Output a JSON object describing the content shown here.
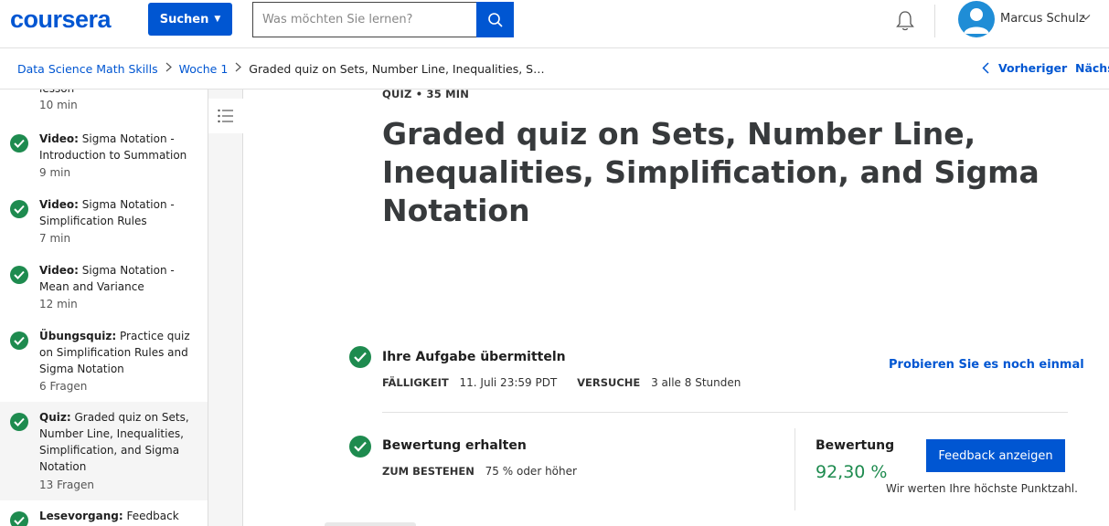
{
  "header": {
    "logo": "coursera",
    "explore_label": "Suchen",
    "search_placeholder": "Was möchten Sie lernen?",
    "user_name": "Marcus Schulz"
  },
  "breadcrumb": {
    "course": "Data Science Math Skills",
    "week": "Woche 1",
    "current": "Graded quiz on Sets, Number Line, Inequalities, S…",
    "prev_label": "Vorheriger",
    "next_label": "Nächs"
  },
  "sidebar": {
    "partial_top": {
      "text": "lesson",
      "meta": "10 min"
    },
    "items": [
      {
        "type": "Video:",
        "title": "Sigma Notation - Introduction to Summation",
        "meta": "9 min"
      },
      {
        "type": "Video:",
        "title": "Sigma Notation - Simplification Rules",
        "meta": "7 min"
      },
      {
        "type": "Video:",
        "title": "Sigma Notation - Mean and Variance",
        "meta": "12 min"
      },
      {
        "type": "Übungsquiz:",
        "title": "Practice quiz on Simplification Rules and Sigma Notation",
        "meta": "6 Fragen"
      },
      {
        "type": "Quiz:",
        "title": "Graded quiz on Sets, Number Line, Inequalities, Simplification, and Sigma Notation",
        "meta": "13 Fragen"
      },
      {
        "type": "Lesevorgang:",
        "title": "Feedback",
        "meta": ""
      }
    ]
  },
  "main": {
    "tag": "QUIZ • 35 MIN",
    "title": "Graded quiz on Sets, Number Line, Inequalities, Simplification, and Sigma Notation",
    "submit": {
      "title": "Ihre Aufgabe übermitteln",
      "due_label": "FÄLLIGKEIT",
      "due_value": "11. Juli 23:59 PDT",
      "attempts_label": "VERSUCHE",
      "attempts_value": "3 alle 8 Stunden",
      "retry_label": "Probieren Sie es noch einmal"
    },
    "grade": {
      "title": "Bewertung erhalten",
      "pass_label": "ZUM BESTEHEN",
      "pass_value": "75 % oder höher",
      "grade_label": "Bewertung",
      "grade_value": "92,30 %",
      "feedback_button": "Feedback anzeigen",
      "note": "Wir werten Ihre höchste Punktzahl."
    }
  },
  "colors": {
    "brand": "#0056d2",
    "success": "#1e8b4f"
  }
}
